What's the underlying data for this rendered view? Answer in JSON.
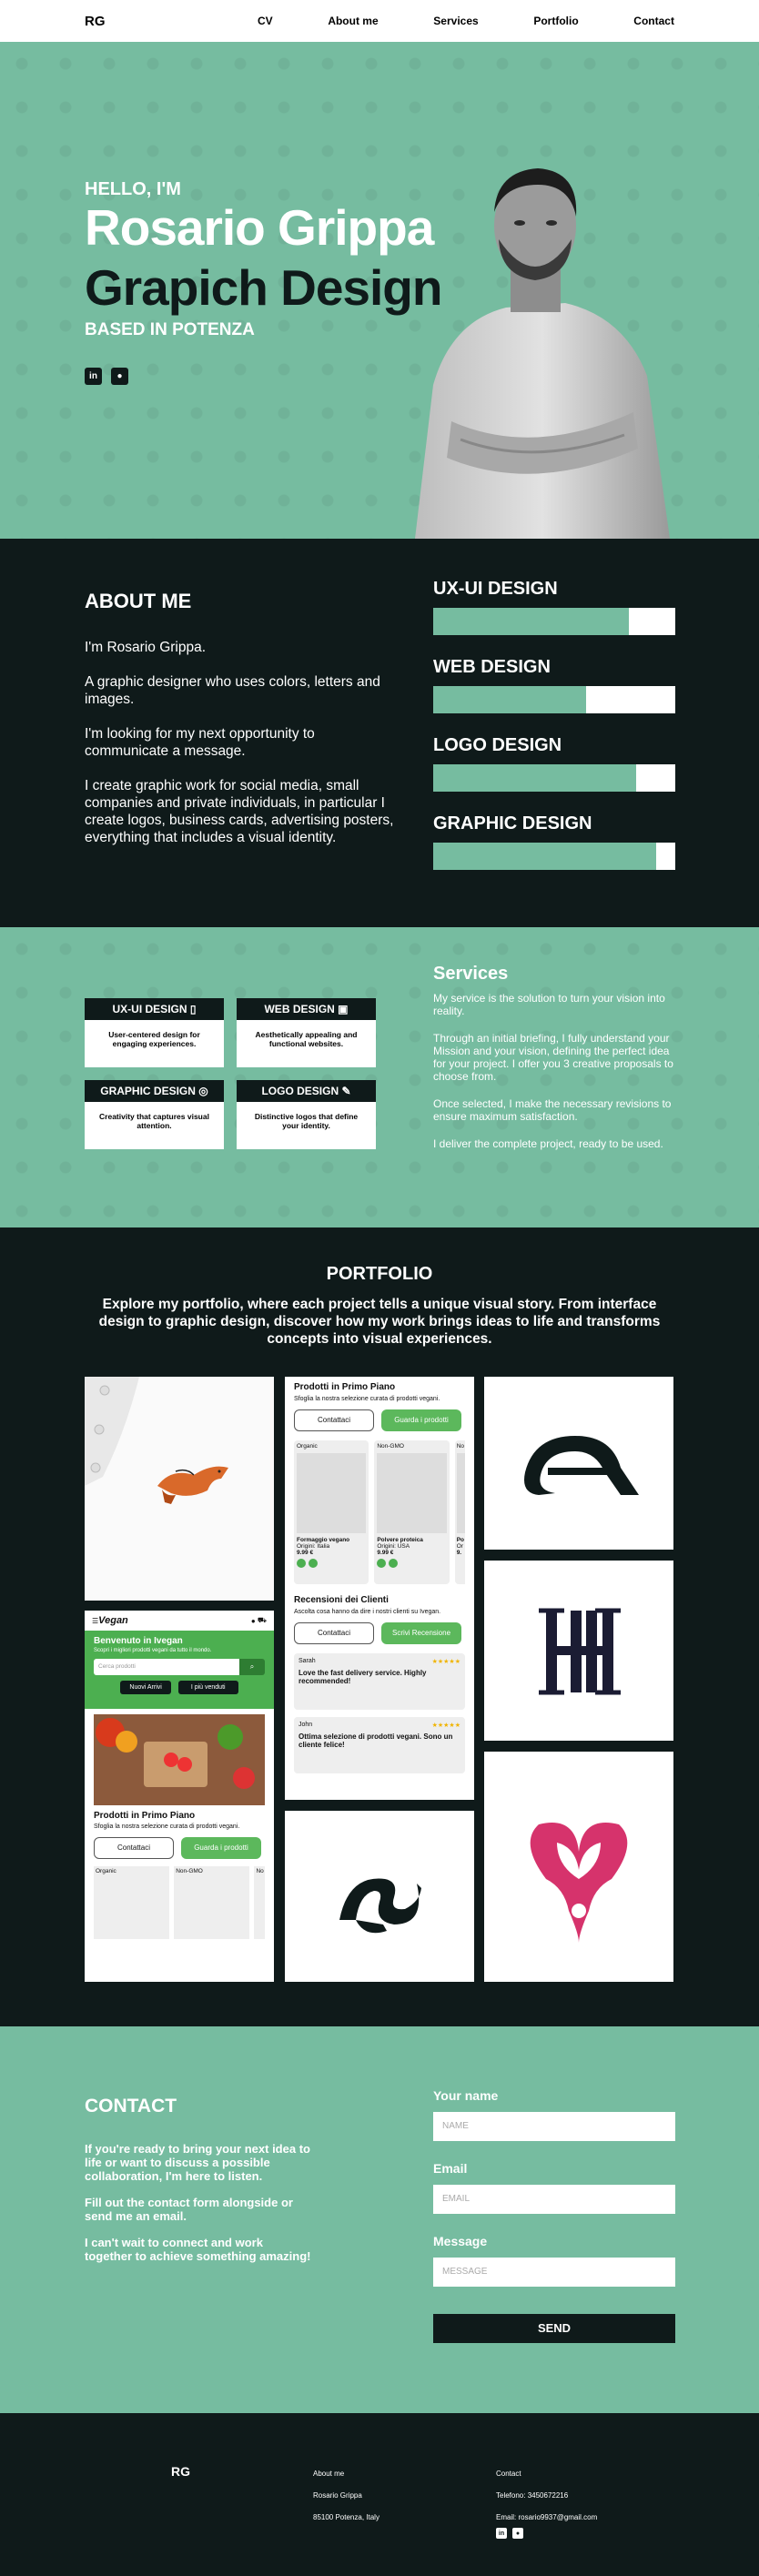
{
  "nav": {
    "logo": "RG",
    "items": [
      "CV",
      "About me",
      "Services",
      "Portfolio",
      "Contact"
    ]
  },
  "hero": {
    "hello": "HELLO, I'M",
    "name": "Rosario Grippa",
    "role": "Grapich Design",
    "based": "BASED IN POTENZA",
    "social": [
      "in",
      "●"
    ]
  },
  "about": {
    "title": "ABOUT ME",
    "bio": [
      "I'm Rosario Grippa.",
      "A graphic designer who uses colors, letters and images.",
      "I'm looking for my next opportunity to communicate a message.",
      "I create graphic work for social media, small companies and private individuals, in particular I create logos, business cards, advertising posters, everything that includes a visual identity."
    ],
    "skills": [
      {
        "label": "UX-UI DESIGN",
        "level": 0.81
      },
      {
        "label": "WEB DESIGN",
        "level": 0.63
      },
      {
        "label": "LOGO DESIGN",
        "level": 0.84
      },
      {
        "label": "GRAPHIC DESIGN",
        "level": 0.92
      }
    ]
  },
  "services": {
    "cards": [
      {
        "title": "UX-UI DESIGN",
        "desc": "User-centered design for engaging experiences.",
        "icon": "phone-icon"
      },
      {
        "title": "WEB DESIGN",
        "desc": "Aesthetically appealing and functional websites.",
        "icon": "browser-icon"
      },
      {
        "title": "GRAPHIC DESIGN",
        "desc": "Creativity that captures visual attention.",
        "icon": "palette-icon"
      },
      {
        "title": "LOGO DESIGN",
        "desc": "Distinctive logos that define your identity.",
        "icon": "pen-icon"
      }
    ],
    "title": "Services",
    "paragraphs": [
      "My service is the solution to turn your vision into reality.",
      "Through an initial briefing, I fully understand your Mission and your vision, defining the perfect idea for your project. I offer you 3 creative proposals to choose from.",
      "Once selected, I make the necessary revisions to ensure maximum satisfaction.",
      "I deliver the complete project, ready to be used."
    ]
  },
  "portfolio": {
    "title": "PORTFOLIO",
    "intro": "Explore my portfolio, where each project tells a unique visual story. From interface design to graphic design, discover how my work brings ideas to life and transforms concepts into visual experiences.",
    "app": {
      "brand": "Vegan",
      "welcome": "Benvenuto in Ivegan",
      "welcome_sub": "Scopri i migliori prodotti vegani da tutto il mondo.",
      "search_placeholder": "Cerca prodotti",
      "btn_new": "Nuovi Arrivi",
      "btn_best": "I più venduti",
      "section": "Prodotti in Primo Piano",
      "section_sub": "Sfoglia la nostra selezione curata di prodotti vegani.",
      "contact": "Contattaci",
      "see_products": "Guarda i prodotti",
      "tags": [
        "Organic",
        "Non-GMO",
        "No"
      ]
    },
    "app2": {
      "section": "Prodotti in Primo Piano",
      "section_sub": "Sfoglia la nostra selezione curata di prodotti vegani.",
      "contact": "Contattaci",
      "see_products": "Guarda i prodotti",
      "products": [
        {
          "tag": "Organic",
          "name": "Formaggio vegano",
          "origin": "Origini: Italia",
          "price": "9.99 €"
        },
        {
          "tag": "Non-GMO",
          "name": "Polvere proteica",
          "origin": "Origini: USA",
          "price": "9.99 €"
        },
        {
          "tag": "No",
          "name": "Po",
          "origin": "Or",
          "price": "9."
        }
      ],
      "reviews_title": "Recensioni dei Clienti",
      "reviews_sub": "Ascolta cosa hanno da dire i nostri clienti su Ivegan.",
      "write_review": "Scrivi Recensione",
      "reviews": [
        {
          "name": "Sarah",
          "text": "Love the fast delivery service. Highly recommended!",
          "stars": "★★★★★"
        },
        {
          "name": "John",
          "text": "Ottima selezione di prodotti vegani. Sono un cliente felice!",
          "stars": "★★★★★"
        }
      ]
    }
  },
  "contact": {
    "title": "CONTACT",
    "paragraphs": [
      "If you're ready to bring your next idea to life or want to discuss a possible collaboration, I'm here to listen.",
      "Fill out the contact form alongside or send me an email.",
      "I can't wait to connect and work together to achieve something amazing!"
    ],
    "name_label": "Your name",
    "name_placeholder": "NAME",
    "email_label": "Email",
    "email_placeholder": "EMAIL",
    "message_label": "Message",
    "message_placeholder": "MESSAGE",
    "send": "SEND"
  },
  "footer": {
    "logo": "RG",
    "about_title": "About me",
    "about_name": "Rosario Grippa",
    "about_city": "85100 Potenza, Italy",
    "contact_title": "Contact",
    "phone": "Telefono: 3450672216",
    "email": "Email: rosario9937@gmail.com"
  },
  "colors": {
    "accent": "#76bca0",
    "dark": "#0f1a1a",
    "green": "#5cb85c",
    "logo_pink": "#d6336c"
  }
}
